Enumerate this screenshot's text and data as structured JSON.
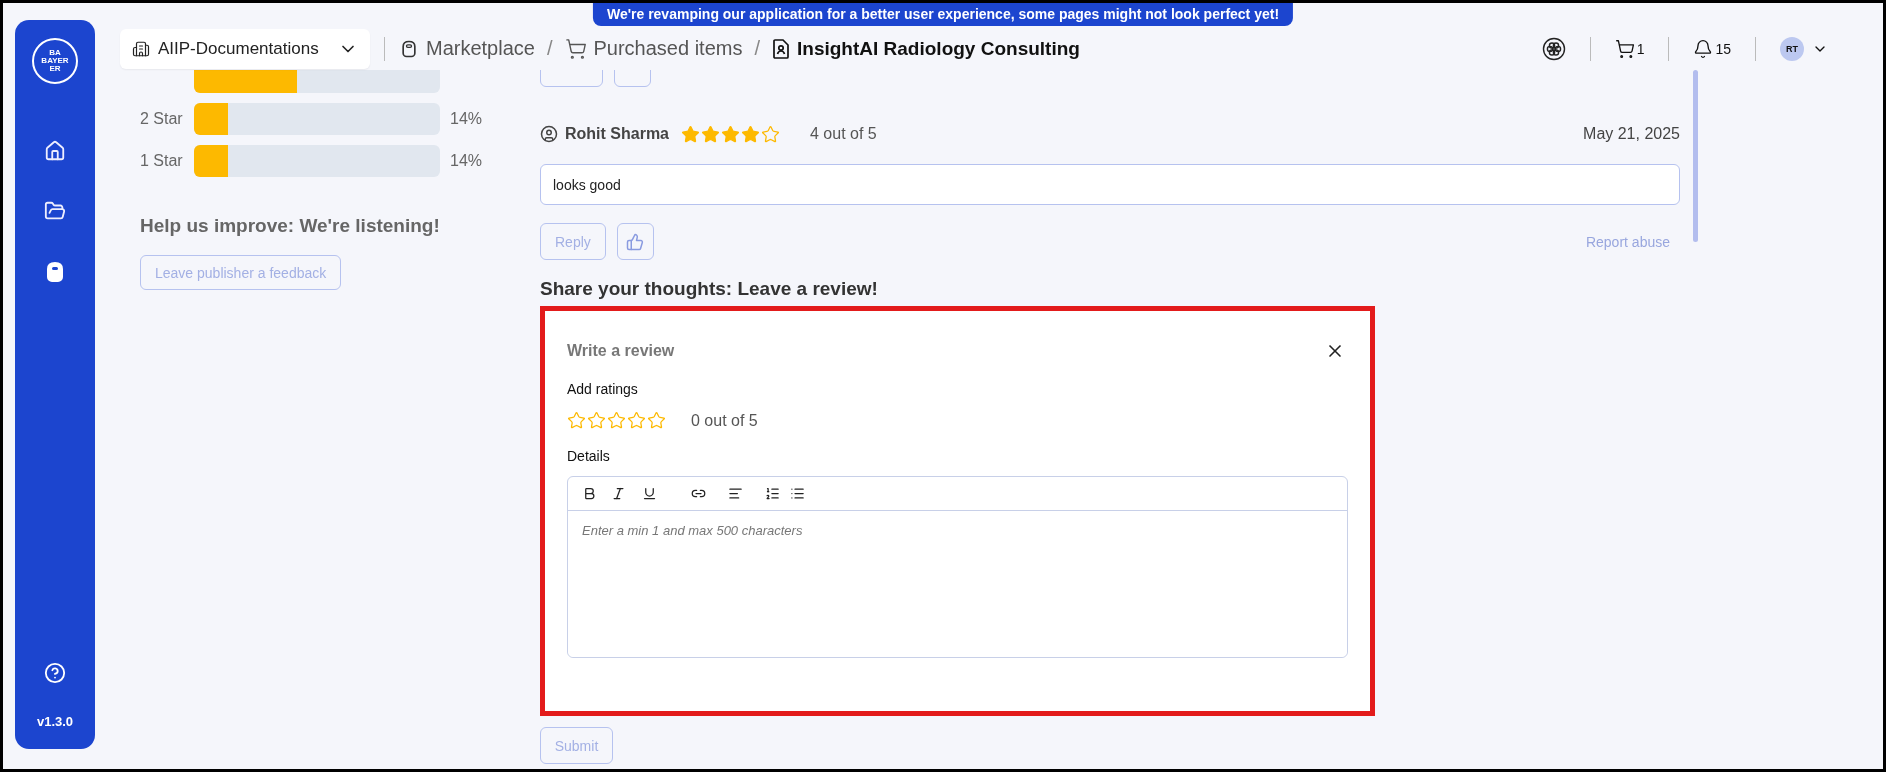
{
  "banner": "We're revamping our application for a better user experience, some pages might not look perfect yet!",
  "sidebar": {
    "logo": {
      "up": "BA",
      "across": "BAYER",
      "down": "ER"
    },
    "items": [
      {
        "kind": "home",
        "selected": false
      },
      {
        "kind": "folder",
        "selected": false
      },
      {
        "kind": "bag",
        "selected": true
      }
    ],
    "version": "v1.3.0"
  },
  "workspace": "AIIP-Documentations",
  "breadcrumb": [
    {
      "kind": "bag",
      "label": "Marketplace",
      "current": false
    },
    {
      "separator": "/",
      "kind": "cart",
      "label": "Purchased items",
      "current": false
    },
    {
      "separator": "/",
      "kind": "document",
      "label": "InsightAI Radiology Consulting",
      "current": true
    }
  ],
  "header": {
    "cart_count": "1",
    "notification_count": "15",
    "avatar": "RT"
  },
  "rating_bars": [
    {
      "level": 0.42
    },
    {
      "label": "2 Star",
      "level": 0.14,
      "percent": "14%"
    },
    {
      "label": "1 Star",
      "level": 0.14,
      "percent": "14%"
    }
  ],
  "feedback": {
    "heading": "Help us improve: We're listening!",
    "button": "Leave publisher a feedback"
  },
  "review": {
    "author": "Rohit Sharma",
    "stars": 4,
    "rating": "4 out of 5",
    "date": "May 21, 2025",
    "comment": "looks good",
    "reply": "Reply",
    "report": "Report abuse"
  },
  "review_form": {
    "section_heading": "Share your thoughts: Leave a review!",
    "highlighted": true,
    "title": "Write a review",
    "ratings_label": "Add ratings",
    "stars": 0,
    "rating": "0 out of 5",
    "details_label": "Details",
    "toolbar": [
      {
        "kind": "bold"
      },
      {
        "kind": "italic"
      },
      {
        "kind": "underline"
      },
      {
        "kind": "link"
      },
      {
        "kind": "align"
      },
      {
        "kind": "ordered"
      },
      {
        "kind": "bullets"
      }
    ],
    "placeholder": "Enter a min 1 and max 500 characters",
    "submit": "Submit"
  }
}
